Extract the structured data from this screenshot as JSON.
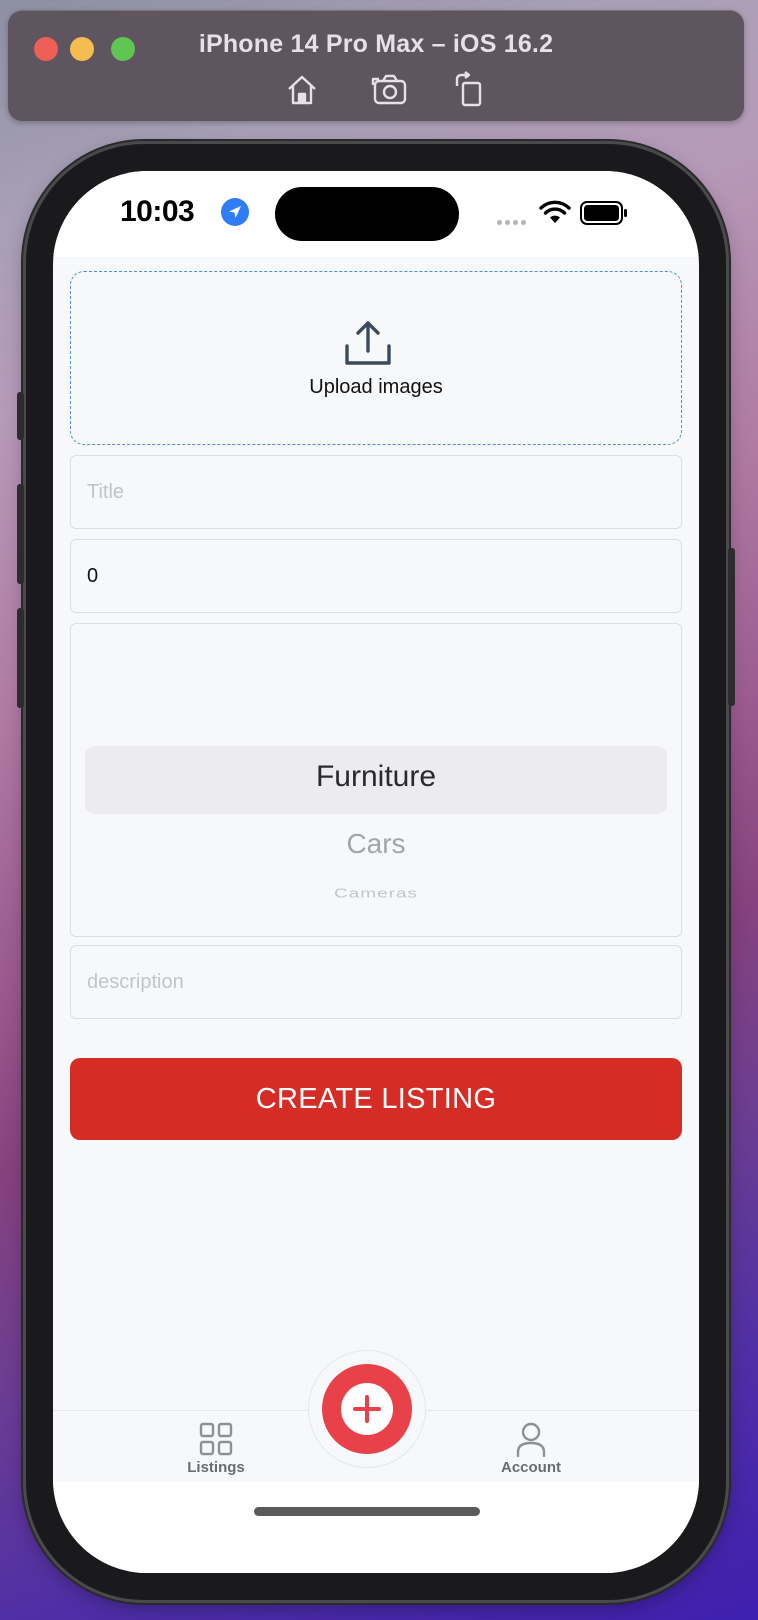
{
  "simulator": {
    "title": "iPhone 14 Pro Max – iOS 16.2",
    "toolbar": [
      "home-icon",
      "screenshot-icon",
      "rotate-icon"
    ]
  },
  "status_bar": {
    "time": "10:03",
    "icons": [
      "location-arrow-icon",
      "signal-dots-icon",
      "wifi-icon",
      "battery-icon"
    ]
  },
  "form": {
    "upload_label": "Upload images",
    "title_placeholder": "Title",
    "title_value": "",
    "price_value": "0",
    "category_options": [
      "Furniture",
      "Cars",
      "Cameras"
    ],
    "category_selected": "Furniture",
    "description_placeholder": "description",
    "description_value": "",
    "submit_label": "CREATE LISTING"
  },
  "tabbar": {
    "listings_label": "Listings",
    "account_label": "Account",
    "fab_icon": "plus-icon"
  },
  "colors": {
    "accent_red": "#d52c25",
    "fab_red": "#e9414a",
    "upload_border": "#4a90d9",
    "screen_bg": "#f7f8fa"
  }
}
